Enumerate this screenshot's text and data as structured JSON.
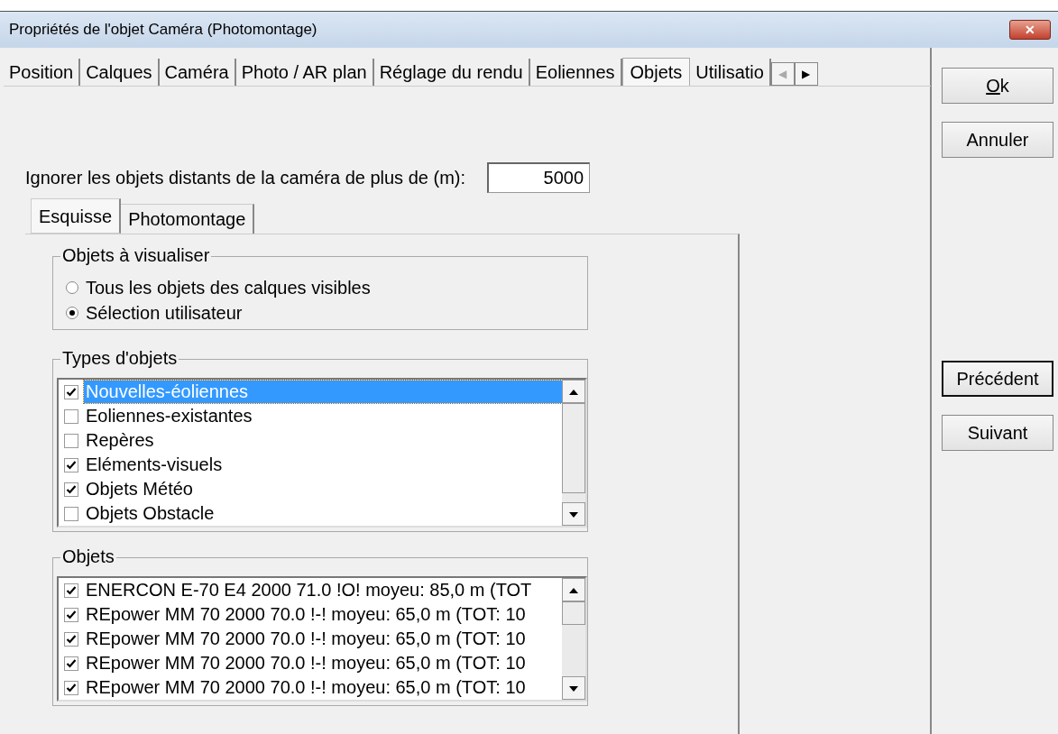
{
  "window": {
    "title": "Propriétés de l'objet Caméra   (Photomontage)",
    "close": "✕"
  },
  "tabs": [
    {
      "label": "Position",
      "selected": false
    },
    {
      "label": "Calques",
      "selected": false
    },
    {
      "label": "Caméra",
      "selected": false
    },
    {
      "label": "Photo / AR plan",
      "selected": false
    },
    {
      "label": "Réglage du rendu",
      "selected": false
    },
    {
      "label": "Eoliennes",
      "selected": false
    },
    {
      "label": "Objets",
      "selected": true
    },
    {
      "label": "Utilisatio",
      "selected": false
    }
  ],
  "tab_scroll": [
    {
      "glyph": "◀",
      "disabled": true
    },
    {
      "glyph": "▶",
      "disabled": false
    }
  ],
  "distance": {
    "label": "Ignorer les objets distants de la caméra de plus de (m):",
    "value": "5000"
  },
  "subtabs": [
    {
      "label": "Esquisse",
      "selected": true
    },
    {
      "label": "Photomontage",
      "selected": false
    }
  ],
  "visualiser": {
    "title": "Objets à visualiser",
    "options": [
      {
        "label": "Tous les objets des calques visibles",
        "selected": false
      },
      {
        "label": "Sélection utilisateur",
        "selected": true
      }
    ]
  },
  "types": {
    "title": "Types d'objets",
    "items": [
      {
        "label": "Nouvelles-éoliennes",
        "checked": true,
        "selected": true
      },
      {
        "label": "Eoliennes-existantes",
        "checked": false,
        "selected": false
      },
      {
        "label": "Repères",
        "checked": false,
        "selected": false
      },
      {
        "label": "Eléments-visuels",
        "checked": true,
        "selected": false
      },
      {
        "label": "Objets Météo",
        "checked": true,
        "selected": false
      },
      {
        "label": "Objets Obstacle",
        "checked": false,
        "selected": false
      }
    ]
  },
  "objets": {
    "title": "Objets",
    "items": [
      {
        "label": "ENERCON E-70 E4 2000 71.0 !O! moyeu: 85,0 m (TOT",
        "checked": true
      },
      {
        "label": "REpower MM 70 2000 70.0 !-! moyeu: 65,0 m (TOT: 10",
        "checked": true
      },
      {
        "label": "REpower MM 70 2000 70.0 !-! moyeu: 65,0 m (TOT: 10",
        "checked": true
      },
      {
        "label": "REpower MM 70 2000 70.0 !-! moyeu: 65,0 m (TOT: 10",
        "checked": true
      },
      {
        "label": "REpower MM 70 2000 70.0 !-! moyeu: 65,0 m (TOT: 10",
        "checked": true
      }
    ]
  },
  "buttons": [
    {
      "label": "Ok",
      "default": false
    },
    {
      "label": "Annuler",
      "default": false
    }
  ],
  "nav_buttons": [
    {
      "label": "Précédent",
      "default": true
    },
    {
      "label": "Suivant",
      "default": false
    }
  ]
}
